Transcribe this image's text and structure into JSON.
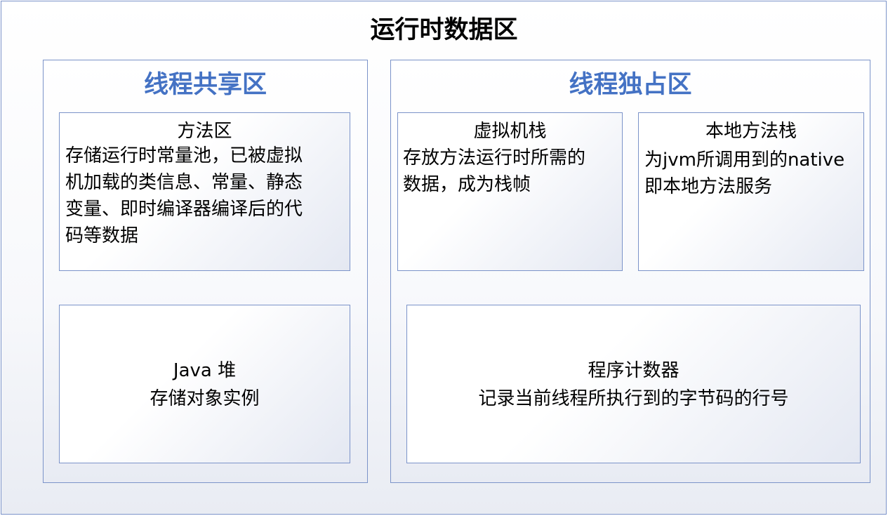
{
  "diagram": {
    "title": "运行时数据区",
    "shared_region": {
      "title": "线程共享区",
      "method_area": {
        "title": "方法区",
        "lines": [
          "存储运行时常量池，已被虚拟",
          "机加载的类信息、常量、静态",
          "变量、即时编译器编译后的代",
          "码等数据"
        ]
      },
      "java_heap": {
        "title": "Java 堆",
        "desc": "存储对象实例"
      }
    },
    "private_region": {
      "title": "线程独占区",
      "vm_stack": {
        "title": "虚拟机栈",
        "lines": [
          "存放方法运行时所需的",
          "数据，成为栈帧"
        ]
      },
      "native_stack": {
        "title": "本地方法栈",
        "lines": [
          "为jvm所调用到的native",
          "即本地方法服务"
        ]
      },
      "pc_register": {
        "title": "程序计数器",
        "desc": "记录当前线程所执行到的字节码的行号"
      }
    }
  }
}
